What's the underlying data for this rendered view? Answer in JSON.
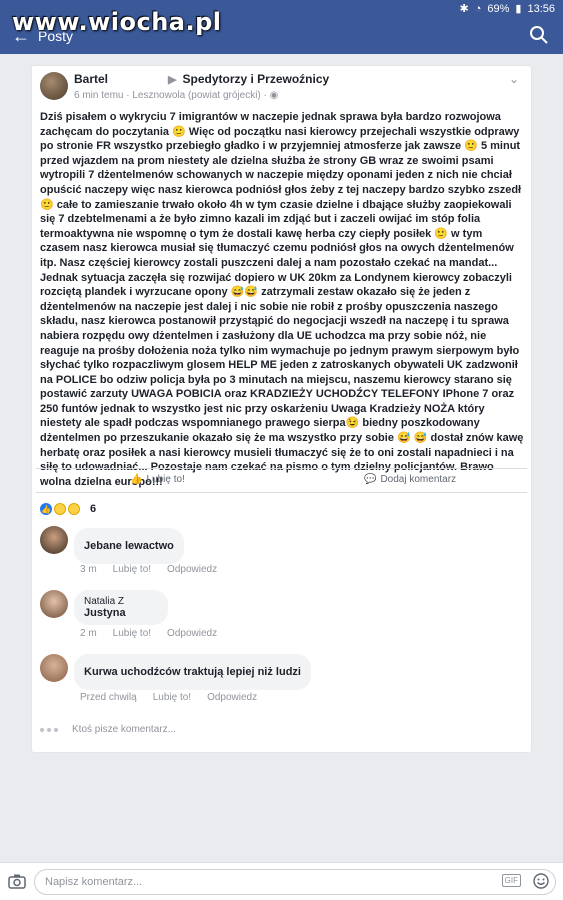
{
  "status": {
    "battery": "69%",
    "time": "13:56"
  },
  "watermark": "www.wiocha.pl",
  "appbar": {
    "title": "Posty"
  },
  "post": {
    "author": "Bartel",
    "group": "Spedytorzy i Przewoźnicy",
    "meta": "6 min temu · Lesznowola (powiat grójecki) · ",
    "text": "Dziś pisałem o wykryciu 7 imigrantów w naczepie jednak sprawa była bardzo rozwojowa zachęcam do poczytania 🙂 Więc od początku nasi kierowcy przejechali wszystkie odprawy po stronie FR wszystko przebiegło gładko i w przyjemniej atmosferze jak zawsze 🙂 5 minut przed wjazdem na prom niestety ale dzielna służba że strony GB wraz ze swoimi psami wytropili 7 dżentelmenów schowanych w naczepie między oponami jeden z nich nie chciał opuścić naczepy więc nasz kierowca podniósł głos żeby z tej naczepy bardzo szybko zszedł 🙂 całe to zamieszanie trwało około 4h w tym czasie dzielne i dbające służby zaopiekowali się 7 dzebtelmenami a że było zimno kazali im zdjąć but i zaczeli owijać im stóp folia termoaktywna nie wspomnę o tym że dostali kawę herba czy ciepły posiłek 🙂 w tym czasem nasz kierowca musiał się tłumaczyć czemu podniósł głos na owych dżentelmenów itp. Nasz częściej kierowcy zostali puszczeni dalej a nam pozostało czekać na mandat... Jednak sytuacja zaczęła się rozwijać dopiero w UK 20km za Londynem kierowcy zobaczyli rozciętą plandek i wyrzucane opony 😅😅 zatrzymali zestaw okazało się że jeden z dżentelmenów na naczepie jest dalej i nic sobie nie robił z prośby opuszczenia naszego składu, nasz kierowca postanowił przystąpić do negocjacji wszedł na naczepę i tu sprawa nabiera rozpędu owy dżentelmen i zasłużony dla UE uchodzca ma przy sobie nóż, nie reaguje na prośby dołożenia noża tylko nim wymachuje po jednym prawym sierpowym było słychać tylko rozpaczliwym glosem HELP ME jeden z zatroskanych obywateli UK zadzwonił na POLICE bo odziw policja była po 3 minutach na miejscu, naszemu kierowcy starano się postawić zarzuty UWAGA POBICIA oraz KRADZIEŻY UCHODŹCY TELEFONY IPhone 7 oraz 250  funtów jednak to wszystko jest nic przy oskarżeniu Uwaga Kradzieży NOŻA który niestety ale spadł podczas wspomnianego prawego sierpa😉 biedny poszkodowany dżentelmen po przeszukanie okazało się że ma wszystko przy sobie 😅 😅 dostał znów kawę herbatę oraz posiłek a nasi kierowcy musieli tłumaczyć się że to oni zostali napadnieci i na siłę to udowadniać... Pozostaje nam czekać na pismo o tym dzielny policjantów. Brawo wolna dzielna europo!!!",
    "like_label": "Lubię to!",
    "comment_label": "Dodaj komentarz",
    "reaction_count": "6"
  },
  "comments": [
    {
      "name": "",
      "text": "Jebane lewactwo",
      "time": "3 m",
      "like": "Lubię to!",
      "reply": "Odpowiedz"
    },
    {
      "name": "Natalia Z",
      "text": "Justyna",
      "time": "2 m",
      "like": "Lubię to!",
      "reply": "Odpowiedz"
    },
    {
      "name": "",
      "text": "Kurwa uchodźców traktują lepiej niż ludzi",
      "time": "Przed chwilą",
      "like": "Lubię to!",
      "reply": "Odpowiedz"
    }
  ],
  "typing": "Ktoś pisze komentarz...",
  "composer": {
    "placeholder": "Napisz komentarz...",
    "gif": "GIF"
  },
  "colors": {
    "brand": "#3b5998",
    "like_blue": "#2078f4"
  }
}
